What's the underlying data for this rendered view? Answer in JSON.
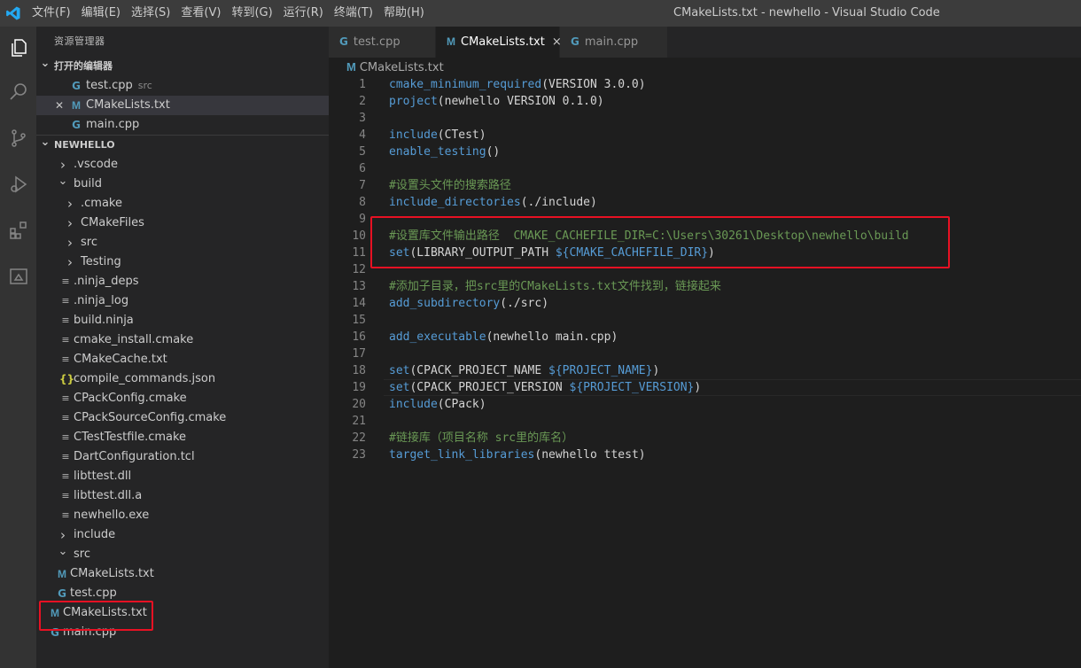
{
  "menu": [
    "文件(F)",
    "编辑(E)",
    "选择(S)",
    "查看(V)",
    "转到(G)",
    "运行(R)",
    "终端(T)",
    "帮助(H)"
  ],
  "window_title": "CMakeLists.txt - newhello - Visual Studio Code",
  "sidebar": {
    "title": "资源管理器",
    "open_editors_header": "打开的编辑器",
    "open_editors": [
      {
        "name": "test.cpp",
        "hint": "src",
        "icon": "cpp-icon"
      },
      {
        "name": "CMakeLists.txt",
        "hint": "",
        "icon": "cmake-icon",
        "close": "×"
      },
      {
        "name": "main.cpp",
        "hint": "",
        "icon": "cpp-icon"
      }
    ],
    "project_header": "NEWHELLO",
    "tree": [
      {
        "name": ".vscode",
        "type": "folder",
        "expanded": false
      },
      {
        "name": "build",
        "type": "folder",
        "expanded": true
      },
      {
        "name": ".cmake",
        "type": "folder",
        "expanded": false
      },
      {
        "name": "CMakeFiles",
        "type": "folder",
        "expanded": false
      },
      {
        "name": "src",
        "type": "folder",
        "expanded": false
      },
      {
        "name": "Testing",
        "type": "folder",
        "expanded": false
      },
      {
        "name": ".ninja_deps",
        "type": "file"
      },
      {
        "name": ".ninja_log",
        "type": "file"
      },
      {
        "name": "build.ninja",
        "type": "file"
      },
      {
        "name": "cmake_install.cmake",
        "type": "file"
      },
      {
        "name": "CMakeCache.txt",
        "type": "file"
      },
      {
        "name": "compile_commands.json",
        "type": "json"
      },
      {
        "name": "CPackConfig.cmake",
        "type": "file"
      },
      {
        "name": "CPackSourceConfig.cmake",
        "type": "file"
      },
      {
        "name": "CTestTestfile.cmake",
        "type": "file"
      },
      {
        "name": "DartConfiguration.tcl",
        "type": "file"
      },
      {
        "name": "libttest.dll",
        "type": "file"
      },
      {
        "name": "libttest.dll.a",
        "type": "file"
      },
      {
        "name": "newhello.exe",
        "type": "file"
      },
      {
        "name": "include",
        "type": "folder",
        "expanded": false
      },
      {
        "name": "src",
        "type": "folder",
        "expanded": true
      },
      {
        "name": "CMakeLists.txt",
        "type": "cmake"
      },
      {
        "name": "test.cpp",
        "type": "cpp"
      },
      {
        "name": "CMakeLists.txt",
        "type": "cmake"
      },
      {
        "name": "main.cpp",
        "type": "cpp"
      }
    ]
  },
  "tabs": [
    {
      "label": "test.cpp",
      "icon": "cpp-icon",
      "active": false
    },
    {
      "label": "CMakeLists.txt",
      "icon": "cmake-icon",
      "active": true,
      "close": "×"
    },
    {
      "label": "main.cpp",
      "icon": "cpp-icon",
      "active": false
    }
  ],
  "breadcrumb": "CMakeLists.txt",
  "code_lines": [
    "cmake_minimum_required(VERSION 3.0.0)",
    "project(newhello VERSION 0.1.0)",
    "",
    "include(CTest)",
    "enable_testing()",
    "",
    "#设置头文件的搜索路径",
    "include_directories(./include)",
    "",
    "#设置库文件输出路径  CMAKE_CACHEFILE_DIR=C:\\Users\\30261\\Desktop\\newhello\\build",
    "set(LIBRARY_OUTPUT_PATH ${CMAKE_CACHEFILE_DIR})",
    "",
    "#添加子目录，把src里的CMakeLists.txt文件找到，链接起来",
    "add_subdirectory(./src)",
    "",
    "add_executable(newhello main.cpp)",
    "",
    "set(CPACK_PROJECT_NAME ${PROJECT_NAME})",
    "set(CPACK_PROJECT_VERSION ${PROJECT_VERSION})",
    "include(CPack)",
    "",
    "#链接库（项目名称 src里的库名）",
    "target_link_libraries(newhello ttest)"
  ],
  "colors": {
    "accent": "#007acc",
    "highlight_box": "#e81123",
    "comment": "#6a9955",
    "keyword": "#569cd6"
  }
}
